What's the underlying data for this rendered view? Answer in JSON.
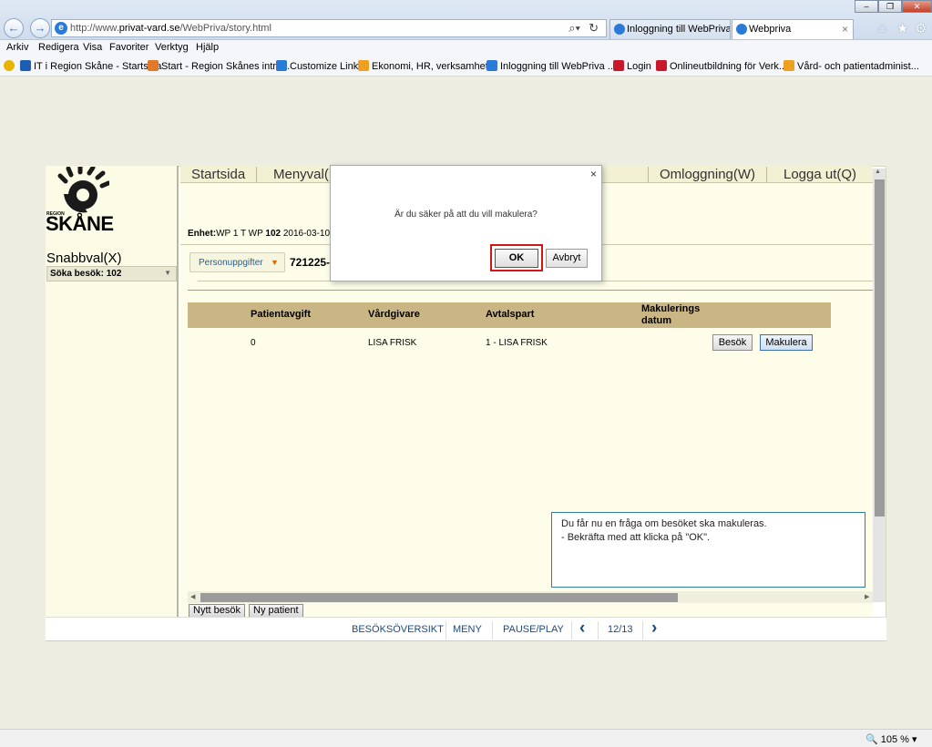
{
  "browser": {
    "url_prefix": "http://www.",
    "url_domain": "privat-vard.se",
    "url_path": "/WebPriva/story.html",
    "tabs": [
      {
        "label": "Inloggning till WebPriva ..."
      },
      {
        "label": "Webpriva"
      }
    ],
    "menu": [
      "Arkiv",
      "Redigera",
      "Visa",
      "Favoriter",
      "Verktyg",
      "Hjälp"
    ],
    "favorites": [
      "IT i Region Skåne - Startsida",
      "Start - Region Skånes intra...",
      "Customize Links",
      "Ekonomi, HR, verksamhet...",
      "Inloggning till WebPriva ...",
      "Login",
      "Onlineutbildning för Verk...",
      "Vård- och patientadminist..."
    ],
    "zoom": "105 %"
  },
  "app": {
    "logo_region": "REGION",
    "logo_name": "SKÅNE",
    "snabbval": "Snabbval(X)",
    "soka_besok": "Söka besök: 102",
    "nav": {
      "startsida": "Startsida",
      "menyval": "Menyval(",
      "omloggning": "Omloggning(W)",
      "logga_ut": "Logga ut(Q)"
    },
    "enhet_label": "Enhet:",
    "enhet_value": "WP 1 T WP",
    "enhet_code": "102",
    "enhet_date": "2016-03-10",
    "person_button": "Personuppgifter",
    "person_id": "721225-",
    "table": {
      "headers": [
        "Patientavgift",
        "Vårdgivare",
        "Avtalspart",
        "Makulerings",
        "datum"
      ],
      "row": {
        "patientavgift": "0",
        "vardgivare": "LISA FRISK",
        "avtalspart": "1 - LISA FRISK"
      },
      "besok_button": "Besök",
      "makulera_button": "Makulera"
    },
    "nytt_besok": "Nytt besök",
    "ny_patient": "Ny patient"
  },
  "dialog": {
    "message": "Är du säker på att du vill makulera?",
    "ok": "OK",
    "cancel": "Avbryt",
    "close": "×"
  },
  "info_box": {
    "line1": "Du får nu en fråga om besöket ska makuleras.",
    "line2": "- Bekräfta med att klicka på \"OK\"."
  },
  "player": {
    "overview": "BESÖKSÖVERSIKT",
    "menu": "MENY",
    "pause_play": "PAUSE/PLAY",
    "page": "12/13"
  },
  "colors": {
    "accent": "#1e4a7a",
    "table_header": "#c9b684",
    "highlight": "#d3161a",
    "info_border": "#2e7d9b"
  }
}
